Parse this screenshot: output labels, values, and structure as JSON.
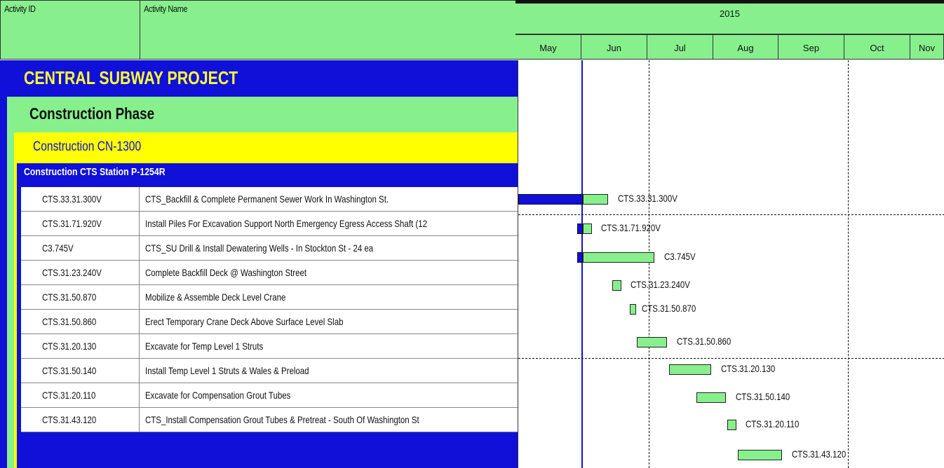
{
  "columns": {
    "activity_id": "Activity ID",
    "activity_name": "Activity Name"
  },
  "timeline": {
    "year": "2015",
    "months": [
      "May",
      "Jun",
      "Jul",
      "Aug",
      "Sep",
      "Oct",
      "Nov"
    ]
  },
  "groups": {
    "project": "CENTRAL SUBWAY PROJECT",
    "phase": "Construction Phase",
    "contract": "Construction CN-1300",
    "station": "Construction CTS Station P-1254R"
  },
  "activities": [
    {
      "id": "CTS.33.31.300V",
      "name": "CTS_Backfill & Complete Permanent Sewer Work In Washington St.",
      "bar_label": "CTS.33.31.300V"
    },
    {
      "id": "CTS.31.71.920V",
      "name": "Install Piles For Excavation Support North Emergency Egress Access Shaft (12",
      "bar_label": "CTS.31.71.920V"
    },
    {
      "id": "C3.745V",
      "name": "CTS_SU Drill & Install Dewatering Wells - In Stockton St - 24 ea",
      "bar_label": "C3.745V"
    },
    {
      "id": "CTS.31.23.240V",
      "name": "Complete Backfill Deck @ Washington Street",
      "bar_label": "CTS.31.23.240V"
    },
    {
      "id": "CTS.31.50.870",
      "name": "Mobilize & Assemble Deck Level Crane",
      "bar_label": "CTS.31.50.870"
    },
    {
      "id": "CTS.31.50.860",
      "name": "Erect Temporary Crane Deck Above Surface Level Slab",
      "bar_label": "CTS.31.50.860"
    },
    {
      "id": "CTS.31.20.130",
      "name": "Excavate for Temp Level 1 Struts",
      "bar_label": "CTS.31.20.130"
    },
    {
      "id": "CTS.31.50.140",
      "name": "Install Temp Level 1 Struts & Wales & Preload",
      "bar_label": "CTS.31.50.140"
    },
    {
      "id": "CTS.31.20.110",
      "name": "Excavate for Compensation Grout Tubes",
      "bar_label": "CTS.31.20.110"
    },
    {
      "id": "CTS.31.43.120",
      "name": "CTS_Install Compensation Grout Tubes & Pretreat - South Of Washington St",
      "bar_label": "CTS.31.43.120"
    }
  ],
  "colors": {
    "header_green": "#87f08d",
    "band_blue": "#1010d8",
    "band_yellow": "#ffff00",
    "project_text": "#ffff33"
  }
}
